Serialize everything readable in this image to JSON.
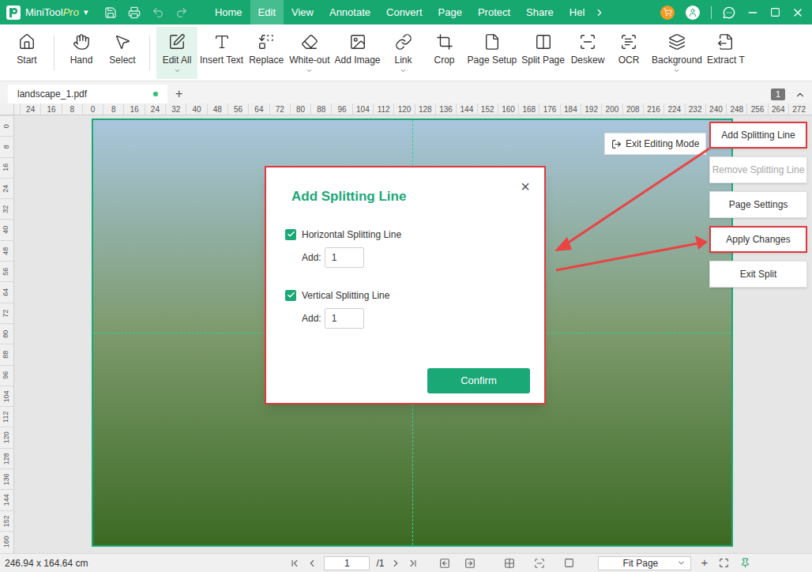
{
  "app": {
    "name": "MiniTool",
    "edition": "Pro",
    "menu_caret": "▾"
  },
  "menus": [
    {
      "label": "Home",
      "selected": false
    },
    {
      "label": "Edit",
      "selected": true
    },
    {
      "label": "View",
      "selected": false
    },
    {
      "label": "Annotate",
      "selected": false
    },
    {
      "label": "Convert",
      "selected": false
    },
    {
      "label": "Page",
      "selected": false
    },
    {
      "label": "Protect",
      "selected": false
    },
    {
      "label": "Share",
      "selected": false
    },
    {
      "label": "Hel",
      "selected": false
    }
  ],
  "toolbar": [
    {
      "label": "Start",
      "selected": false,
      "dropdown": false
    },
    {
      "label": "Hand",
      "selected": false,
      "dropdown": false
    },
    {
      "label": "Select",
      "selected": false,
      "dropdown": false
    },
    {
      "label": "Edit All",
      "selected": true,
      "dropdown": true
    },
    {
      "label": "Insert Text",
      "selected": false,
      "dropdown": false
    },
    {
      "label": "Replace",
      "selected": false,
      "dropdown": false
    },
    {
      "label": "White-out",
      "selected": false,
      "dropdown": true
    },
    {
      "label": "Add Image",
      "selected": false,
      "dropdown": false
    },
    {
      "label": "Link",
      "selected": false,
      "dropdown": true
    },
    {
      "label": "Crop",
      "selected": false,
      "dropdown": false
    },
    {
      "label": "Page Setup",
      "selected": false,
      "dropdown": false
    },
    {
      "label": "Split Page",
      "selected": false,
      "dropdown": false
    },
    {
      "label": "Deskew",
      "selected": false,
      "dropdown": false
    },
    {
      "label": "OCR",
      "selected": false,
      "dropdown": false
    },
    {
      "label": "Background",
      "selected": false,
      "dropdown": true
    },
    {
      "label": "Extract T",
      "selected": false,
      "dropdown": false
    }
  ],
  "tabs": [
    {
      "label": "landscape_1.pdf",
      "selected": true,
      "modified": true
    }
  ],
  "tab_add": "+",
  "page_count_badge": "1",
  "ruler": {
    "horizontal": [
      "24",
      "16",
      "8",
      "0",
      "8",
      "16",
      "24",
      "32",
      "40",
      "48",
      "56",
      "64",
      "72",
      "80",
      "88",
      "96",
      "104",
      "112",
      "120",
      "128",
      "136",
      "144",
      "152",
      "160",
      "168",
      "176",
      "184",
      "192",
      "200",
      "208",
      "216",
      "224",
      "232",
      "240",
      "248",
      "256",
      "264",
      "272"
    ],
    "vertical": [
      "0",
      "8",
      "16",
      "24",
      "32",
      "40",
      "48",
      "56",
      "64",
      "72",
      "80",
      "88",
      "96",
      "104",
      "112",
      "120",
      "128",
      "136",
      "144",
      "152",
      "160"
    ]
  },
  "exit_editing": "Exit Editing Mode",
  "split_menu": [
    {
      "label": "Add Splitting Line",
      "disabled": false,
      "highlighted": true
    },
    {
      "label": "Remove Splitting Line",
      "disabled": true,
      "highlighted": false
    },
    {
      "label": "Page Settings",
      "disabled": false,
      "highlighted": false
    },
    {
      "label": "Apply Changes",
      "disabled": false,
      "highlighted": true
    },
    {
      "label": "Exit Split",
      "disabled": false,
      "highlighted": false
    }
  ],
  "dialog": {
    "title": "Add Splitting Line",
    "close": "×",
    "highlighted": true,
    "options": [
      {
        "label": "Horizontal Splitting Line",
        "checked": true,
        "add_label": "Add:",
        "value": "1",
        "direction": "horizontal"
      },
      {
        "label": "Vertical Splitting Line",
        "checked": true,
        "add_label": "Add:",
        "value": "1",
        "direction": "vertical"
      }
    ],
    "confirm": "Confirm"
  },
  "status_bar": {
    "dimensions": "246.94 x 164.64 cm",
    "page": "1",
    "total": "/1",
    "zoom": "Fit Page",
    "zoom_in": "+"
  }
}
